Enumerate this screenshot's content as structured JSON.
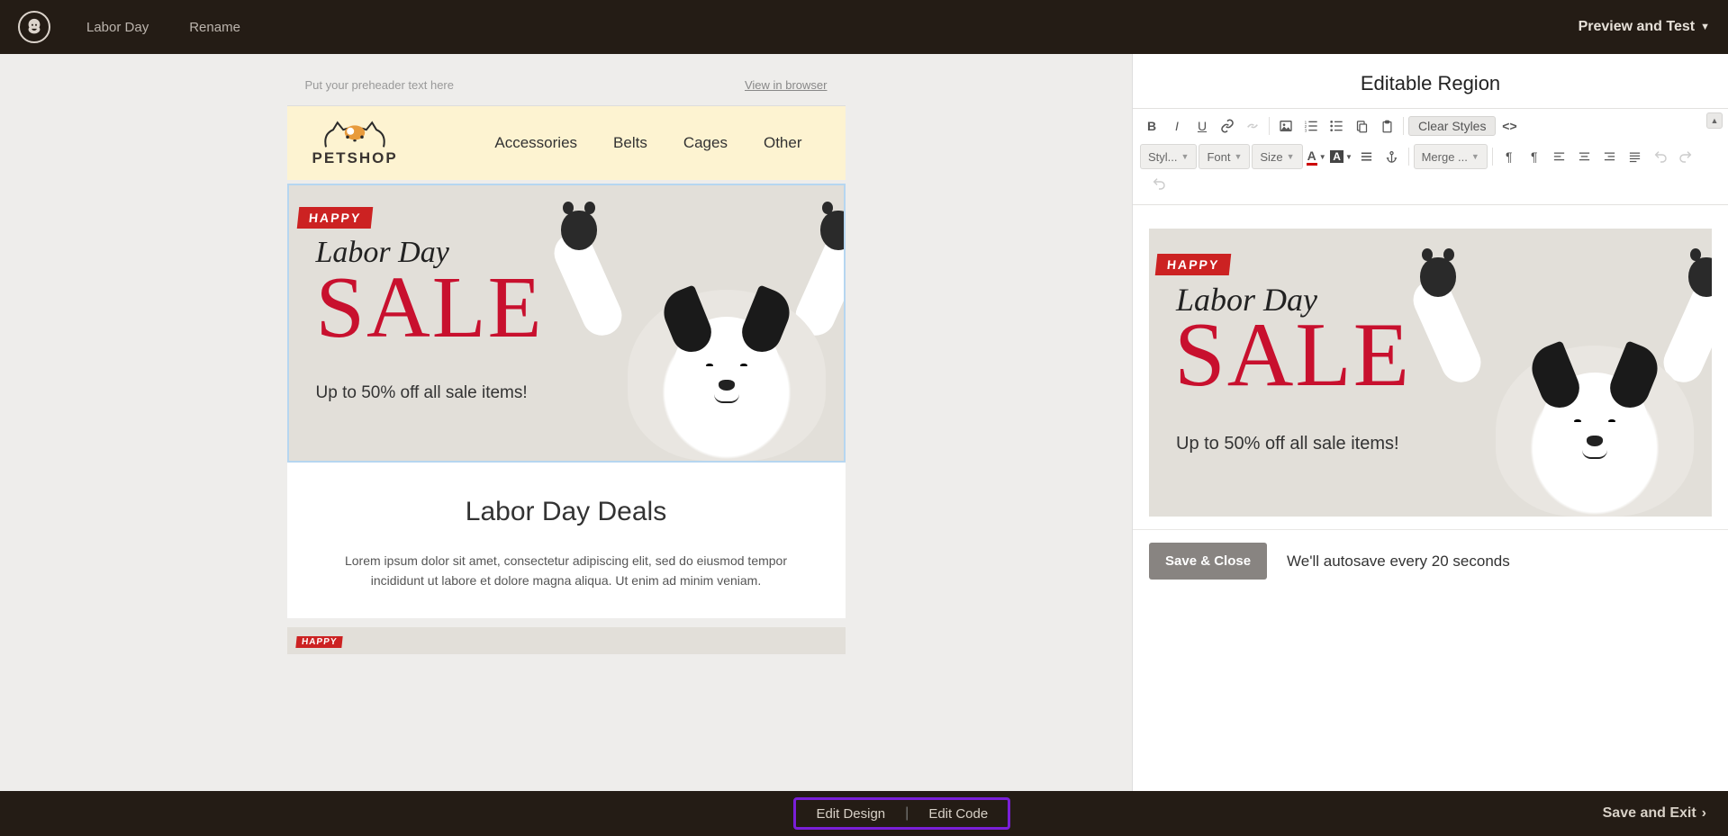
{
  "topbar": {
    "campaign_name": "Labor Day",
    "rename": "Rename",
    "preview_test": "Preview and Test"
  },
  "preview": {
    "preheader_placeholder": "Put your preheader text here",
    "view_in_browser": "View in browser",
    "brand": "PETSHOP",
    "nav": [
      "Accessories",
      "Belts",
      "Cages",
      "Other"
    ],
    "hero": {
      "badge": "HAPPY",
      "headline_script": "Labor Day",
      "headline_main": "SALE",
      "subline": "Up to 50% off all sale items!"
    },
    "deals": {
      "title": "Labor Day Deals",
      "body": "Lorem ipsum dolor sit amet, consectetur adipiscing elit, sed do eiusmod tempor incididunt ut labore et dolore magna aliqua. Ut enim ad minim veniam."
    }
  },
  "editor": {
    "panel_title": "Editable Region",
    "toolbar": {
      "styles": "Styl...",
      "font": "Font",
      "size": "Size",
      "clear_styles": "Clear Styles",
      "merge": "Merge ..."
    },
    "save_close": "Save & Close",
    "autosave": "We'll autosave every 20 seconds"
  },
  "bottombar": {
    "edit_design": "Edit Design",
    "edit_code": "Edit Code",
    "save_exit": "Save and Exit"
  }
}
